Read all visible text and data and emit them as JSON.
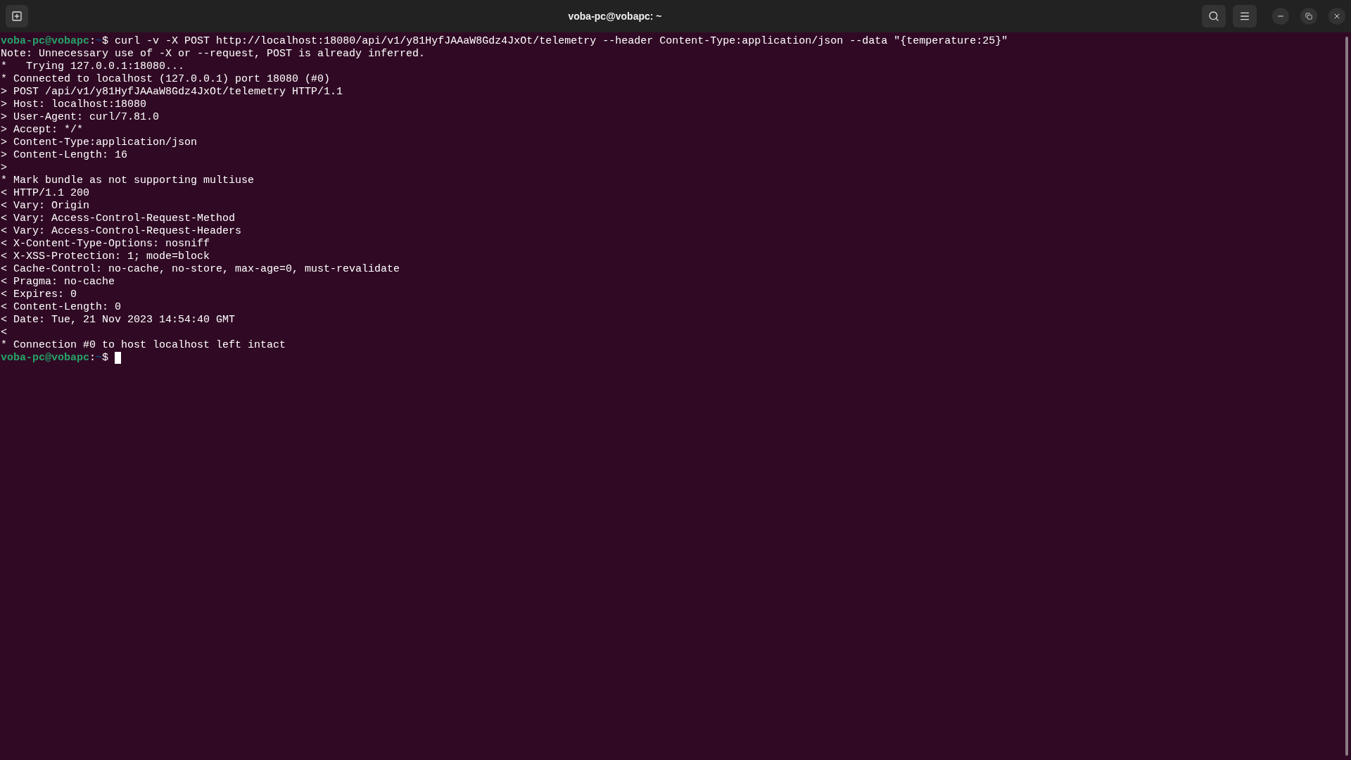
{
  "window": {
    "title": "voba-pc@vobapc: ~"
  },
  "lines": [
    {
      "kind": "prompt",
      "host": "voba-pc@vobapc",
      "sep": ":",
      "path": "~",
      "symbol": "$",
      "command": "curl -v -X POST http://localhost:18080/api/v1/y81HyfJAAaW8Gdz4JxOt/telemetry --header Content-Type:application/json --data \"{temperature:25}\""
    },
    {
      "kind": "output",
      "text": "Note: Unnecessary use of -X or --request, POST is already inferred."
    },
    {
      "kind": "output",
      "text": "*   Trying 127.0.0.1:18080..."
    },
    {
      "kind": "output",
      "text": "* Connected to localhost (127.0.0.1) port 18080 (#0)"
    },
    {
      "kind": "output",
      "text": "> POST /api/v1/y81HyfJAAaW8Gdz4JxOt/telemetry HTTP/1.1"
    },
    {
      "kind": "output",
      "text": "> Host: localhost:18080"
    },
    {
      "kind": "output",
      "text": "> User-Agent: curl/7.81.0"
    },
    {
      "kind": "output",
      "text": "> Accept: */*"
    },
    {
      "kind": "output",
      "text": "> Content-Type:application/json"
    },
    {
      "kind": "output",
      "text": "> Content-Length: 16"
    },
    {
      "kind": "output",
      "text": ">"
    },
    {
      "kind": "output",
      "text": "* Mark bundle as not supporting multiuse"
    },
    {
      "kind": "output",
      "text": "< HTTP/1.1 200"
    },
    {
      "kind": "output",
      "text": "< Vary: Origin"
    },
    {
      "kind": "output",
      "text": "< Vary: Access-Control-Request-Method"
    },
    {
      "kind": "output",
      "text": "< Vary: Access-Control-Request-Headers"
    },
    {
      "kind": "output",
      "text": "< X-Content-Type-Options: nosniff"
    },
    {
      "kind": "output",
      "text": "< X-XSS-Protection: 1; mode=block"
    },
    {
      "kind": "output",
      "text": "< Cache-Control: no-cache, no-store, max-age=0, must-revalidate"
    },
    {
      "kind": "output",
      "text": "< Pragma: no-cache"
    },
    {
      "kind": "output",
      "text": "< Expires: 0"
    },
    {
      "kind": "output",
      "text": "< Content-Length: 0"
    },
    {
      "kind": "output",
      "text": "< Date: Tue, 21 Nov 2023 14:54:40 GMT"
    },
    {
      "kind": "output",
      "text": "<"
    },
    {
      "kind": "output",
      "text": "* Connection #0 to host localhost left intact"
    },
    {
      "kind": "prompt",
      "host": "voba-pc@vobapc",
      "sep": ":",
      "path": "~",
      "symbol": "$",
      "cursor": true
    }
  ]
}
